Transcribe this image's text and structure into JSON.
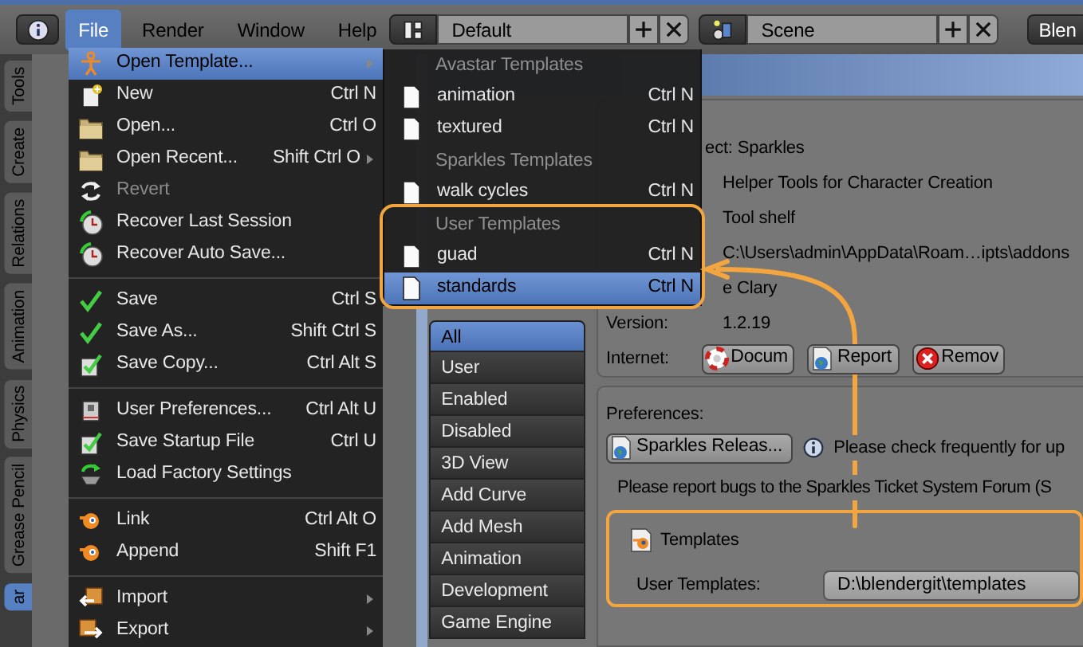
{
  "top_bar": {
    "menus": [
      {
        "label": "File",
        "selected": true
      },
      {
        "label": "Render",
        "selected": false
      },
      {
        "label": "Window",
        "selected": false
      },
      {
        "label": "Help",
        "selected": false
      }
    ],
    "layout_field": "Default",
    "scene_field": "Scene",
    "engine_button": "Blen"
  },
  "side_tabs": [
    {
      "label": "Tools",
      "selected": false
    },
    {
      "label": "Create",
      "selected": false
    },
    {
      "label": "Relations",
      "selected": false
    },
    {
      "label": "Animation",
      "selected": false
    },
    {
      "label": "Physics",
      "selected": false
    },
    {
      "label": "Grease Pencil",
      "selected": false
    },
    {
      "label": "ar",
      "selected": true
    }
  ],
  "file_menu": {
    "sections": [
      {
        "items": [
          {
            "label": "Open Template...",
            "submenu": true,
            "disabled": false,
            "selected": true
          },
          {
            "label": "New",
            "shortcut": "Ctrl N",
            "submenu": false,
            "disabled": false,
            "selected": false
          },
          {
            "label": "Open...",
            "shortcut": "Ctrl O",
            "submenu": false,
            "disabled": false,
            "selected": false
          },
          {
            "label": "Open Recent...",
            "shortcut": "Shift Ctrl O",
            "submenu": true,
            "disabled": false,
            "selected": false
          },
          {
            "label": "Revert",
            "submenu": false,
            "disabled": true,
            "selected": false
          },
          {
            "label": "Recover Last Session",
            "submenu": false,
            "disabled": false,
            "selected": false
          },
          {
            "label": "Recover Auto Save...",
            "submenu": false,
            "disabled": false,
            "selected": false
          }
        ]
      },
      {
        "items": [
          {
            "label": "Save",
            "shortcut": "Ctrl S",
            "submenu": false,
            "disabled": false,
            "selected": false
          },
          {
            "label": "Save As...",
            "shortcut": "Shift Ctrl S",
            "submenu": false,
            "disabled": false,
            "selected": false
          },
          {
            "label": "Save Copy...",
            "shortcut": "Ctrl Alt S",
            "submenu": false,
            "disabled": false,
            "selected": false
          }
        ]
      },
      {
        "items": [
          {
            "label": "User Preferences...",
            "shortcut": "Ctrl Alt U",
            "submenu": false,
            "disabled": false,
            "selected": false
          },
          {
            "label": "Save Startup File",
            "shortcut": "Ctrl U",
            "submenu": false,
            "disabled": false,
            "selected": false
          },
          {
            "label": "Load Factory Settings",
            "submenu": false,
            "disabled": false,
            "selected": false
          }
        ]
      },
      {
        "items": [
          {
            "label": "Link",
            "shortcut": "Ctrl Alt O",
            "submenu": false,
            "disabled": false,
            "selected": false
          },
          {
            "label": "Append",
            "shortcut": "Shift F1",
            "submenu": false,
            "disabled": false,
            "selected": false
          }
        ]
      },
      {
        "items": [
          {
            "label": "Import",
            "submenu": true,
            "disabled": false,
            "selected": false
          },
          {
            "label": "Export",
            "submenu": true,
            "disabled": false,
            "selected": false
          }
        ]
      }
    ]
  },
  "template_submenu": {
    "groups": [
      {
        "header": "Avastar Templates",
        "highlighted": false,
        "items": [
          {
            "label": "animation",
            "shortcut": "Ctrl N",
            "selected": false
          },
          {
            "label": "textured",
            "shortcut": "Ctrl N",
            "selected": false
          }
        ]
      },
      {
        "header": "Sparkles Templates",
        "highlighted": false,
        "items": [
          {
            "label": "walk cycles",
            "shortcut": "Ctrl N",
            "selected": false
          }
        ]
      },
      {
        "header": "User Templates",
        "highlighted": true,
        "items": [
          {
            "label": "guad",
            "shortcut": "Ctrl N",
            "selected": false
          },
          {
            "label": "standards",
            "shortcut": "Ctrl N",
            "selected": true
          }
        ]
      }
    ]
  },
  "categories": [
    {
      "label": "All",
      "selected": true
    },
    {
      "label": "User",
      "selected": false
    },
    {
      "label": "Enabled",
      "selected": false
    },
    {
      "label": "Disabled",
      "selected": false
    },
    {
      "label": "3D View",
      "selected": false
    },
    {
      "label": "Add Curve",
      "selected": false
    },
    {
      "label": "Add Mesh",
      "selected": false
    },
    {
      "label": "Animation",
      "selected": false
    },
    {
      "label": "Development",
      "selected": false
    },
    {
      "label": "Game Engine",
      "selected": false
    }
  ],
  "addon_info": {
    "heading": "ect: Sparkles",
    "rows": [
      {
        "value": "Helper Tools for Character Creation"
      },
      {
        "value": "Tool shelf"
      },
      {
        "value": "C:\\Users\\admin\\AppData\\Roam…ipts\\addons"
      },
      {
        "value": "e Clary"
      },
      {
        "label": "Version:",
        "value": "1.2.19"
      }
    ],
    "internet": {
      "label": "Internet:",
      "buttons": [
        "Docum",
        "Report",
        "Remov"
      ]
    }
  },
  "preferences": {
    "label": "Preferences:",
    "release_button": "Sparkles Releas...",
    "info_text": "Please check frequently for up",
    "report_text": "Please report bugs to the Sparkles Ticket System Forum (S",
    "templates": {
      "title": "Templates",
      "highlighted": true,
      "field_label": "User Templates:",
      "value": "D:\\blendergit\\templates"
    }
  }
}
